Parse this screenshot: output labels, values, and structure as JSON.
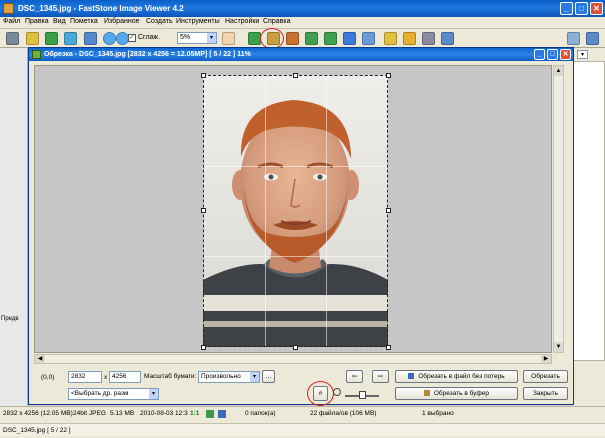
{
  "app": {
    "title": "DSC_1345.jpg  -  FastStone Image Viewer 4.2",
    "window_min": "_",
    "window_max": "□",
    "window_close": "✕"
  },
  "menu": [
    "Файл",
    "Правка",
    "Вид",
    "Пометка",
    "Избранное",
    "Создать",
    "Инструменты",
    "Настройки",
    "Справка"
  ],
  "toolbar": {
    "smooth_checked": "✓",
    "smooth_label": "Сглаж.",
    "zoom_value": "5%",
    "dropdown_arrow": "▾"
  },
  "left_panel": {
    "preview_label": "Предв"
  },
  "dialog": {
    "title": "Обрезка  -  DSC_1345.jpg  [2832 x 4256 = 12.05MP]  [ 5 / 22 ]    11%",
    "min": "_",
    "max": "□",
    "close": "✕",
    "origin": "(0,0)",
    "width_value": "2832",
    "times": "x",
    "height_value": "4256",
    "scale_label": "Масштаб бумаги:",
    "scale_value": "Произвольно",
    "more_button": "...",
    "preset_value": "<Выбрать др. разм",
    "prev_arrow": "⇦",
    "next_arrow": "⇨",
    "crop_lossless": "Обрезать в файл без потерь",
    "crop": "Обрезать",
    "crop_clipboard": "Обрезать в буфер",
    "close_button": "Закрыть",
    "grid_icon_glyph": "#"
  },
  "status": {
    "dims": "2832 x 4256 (12.05 MB)",
    "format": "24bit JPEG",
    "size": "5.13 MB",
    "date": "2010-08-03 12:3",
    "ratio": "1:1",
    "folders": "0 папок(а)",
    "files": "22 файла/ов (106 MB)",
    "selected": "1 выбрано",
    "file_index": "DSC_1345.jpg [ 5 / 22 ]"
  },
  "colors": {
    "titlebar": "#0b60c8",
    "annotation_red": "#d91e1e",
    "canvas_gray": "#c6c6c6"
  }
}
